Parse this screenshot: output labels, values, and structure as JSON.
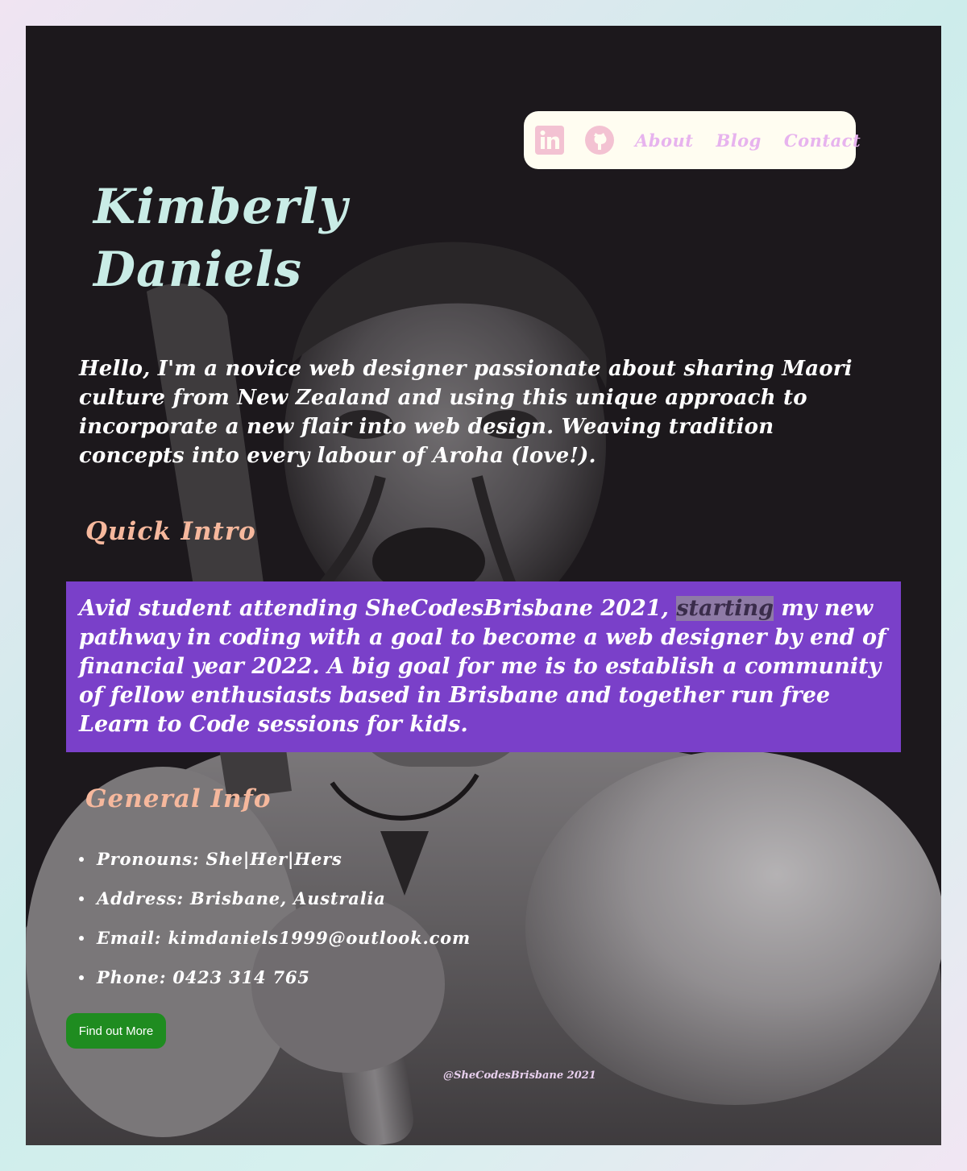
{
  "nav": {
    "icons": [
      "linkedin-icon",
      "github-icon"
    ],
    "links": [
      "About",
      "Blog",
      "Contact"
    ]
  },
  "profile": {
    "first_name": "Kimberly",
    "last_name": "Daniels",
    "hello": "Hello, I'm a novice web designer passionate about sharing Maori culture from New Zealand and using this unique approach to incorporate a new flair into web design. Weaving tradition concepts into every labour of Aroha (love!)."
  },
  "quick_intro": {
    "heading": "Quick Intro",
    "text_before": "Avid student attending SheCodesBrisbane 2021, ",
    "highlight": "starting",
    "text_after": " my new pathway in coding with a goal to become a web designer by end of financial year 2022. A big goal for me is to establish a community of fellow enthusiasts based in Brisbane and together run free Learn to Code sessions for kids."
  },
  "general_info": {
    "heading": "General Info",
    "items": [
      "Pronouns: She|Her|Hers",
      "Address: Brisbane, Australia",
      "Email: kimdaniels1999@outlook.com",
      "Phone: 0423 314 765"
    ]
  },
  "button_label": "Find out More",
  "footer": "@SheCodesBrisbane 2021",
  "colors": {
    "name": "#c9ece6",
    "heading": "#f6b89d",
    "nav_link": "#e7b3ee",
    "intro_box": "#7a40c9",
    "button": "#1f8c20"
  }
}
